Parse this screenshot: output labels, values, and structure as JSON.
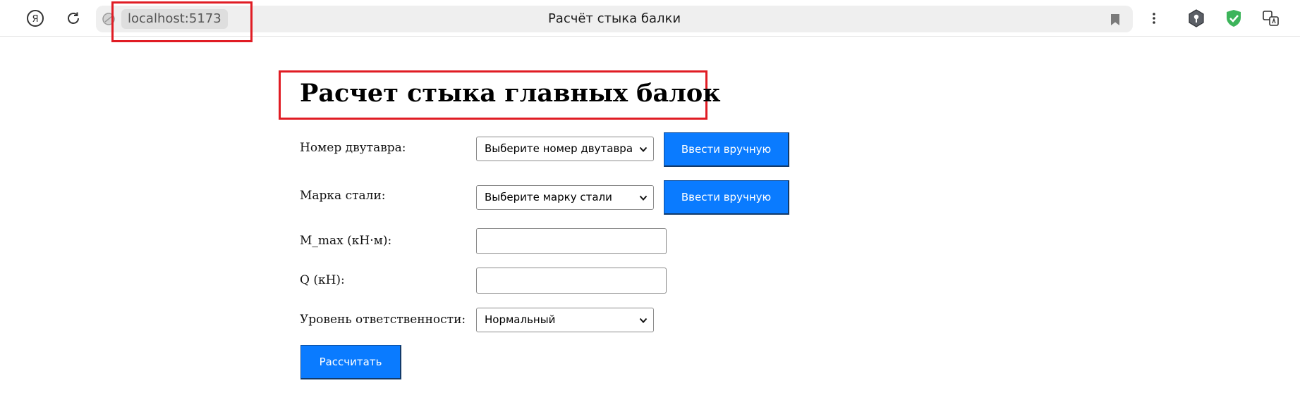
{
  "browser": {
    "url": "localhost:5173",
    "tab_title": "Расчёт стыка балки"
  },
  "page": {
    "title": "Расчет стыка главных балок",
    "beam_number": {
      "label": "Номер двутавра:",
      "value": "Выберите номер двутавра",
      "manual_button": "Ввести вручную"
    },
    "steel_grade": {
      "label": "Марка стали:",
      "value": "Выберите марку стали",
      "manual_button": "Ввести вручную"
    },
    "m_max": {
      "label": "M_max (кН·м):",
      "value": ""
    },
    "q": {
      "label": "Q (кН):",
      "value": ""
    },
    "responsibility": {
      "label": "Уровень ответственности:",
      "value": "Нормальный"
    },
    "calculate_button": "Рассчитать"
  },
  "colors": {
    "accent": "#0a7bff",
    "highlight": "#e01c24"
  }
}
